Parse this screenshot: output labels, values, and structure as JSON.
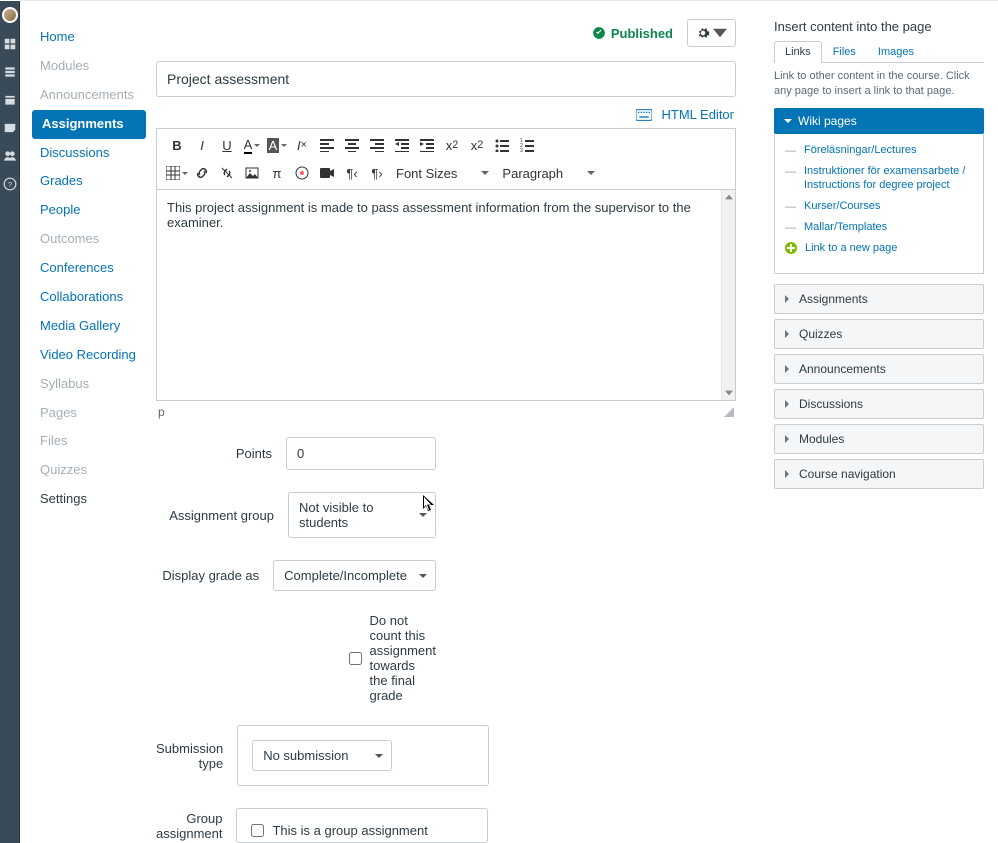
{
  "nav": {
    "home": "Home",
    "modules": "Modules",
    "announcements": "Announcements",
    "assignments": "Assignments",
    "discussions": "Discussions",
    "grades": "Grades",
    "people": "People",
    "outcomes": "Outcomes",
    "conferences": "Conferences",
    "collaborations": "Collaborations",
    "media_gallery": "Media Gallery",
    "video_recording": "Video Recording",
    "syllabus": "Syllabus",
    "pages": "Pages",
    "files": "Files",
    "quizzes": "Quizzes",
    "settings": "Settings"
  },
  "header": {
    "published": "Published",
    "title_value": "Project assessment",
    "html_editor": "HTML Editor"
  },
  "editor": {
    "font_sizes": "Font Sizes",
    "paragraph": "Paragraph",
    "body": "This project assignment is made to pass assessment information from the supervisor to the examiner.",
    "path": "p"
  },
  "form": {
    "points_label": "Points",
    "points_value": "0",
    "group_label": "Assignment group",
    "group_value": "Not visible to students",
    "display_label": "Display grade as",
    "display_value": "Complete/Incomplete",
    "nocount": "Do not count this assignment towards the final grade",
    "submission_label": "Submission type",
    "submission_value": "No submission",
    "groupassign_label": "Group assignment",
    "groupassign_check": "This is a group assignment"
  },
  "sidebar": {
    "title": "Insert content into the page",
    "tabs": {
      "links": "Links",
      "files": "Files",
      "images": "Images"
    },
    "help": "Link to other content in the course. Click any page to insert a link to that page.",
    "wiki_head": "Wiki pages",
    "wiki": {
      "a": "Föreläsningar/Lectures",
      "b": "Instruktioner för examensarbete / Instructions for degree project",
      "c": "Kurser/Courses",
      "d": "Mallar/Templates",
      "new": "Link to a new page"
    },
    "sections": {
      "assignments": "Assignments",
      "quizzes": "Quizzes",
      "announcements": "Announcements",
      "discussions": "Discussions",
      "modules": "Modules",
      "coursenav": "Course navigation"
    }
  }
}
